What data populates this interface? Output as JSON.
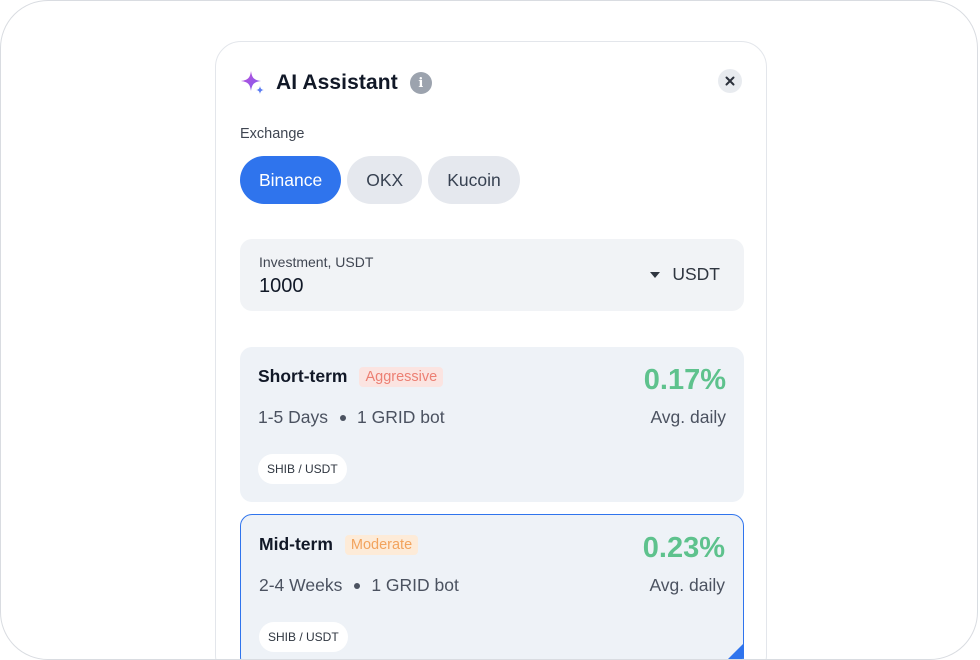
{
  "assistant": {
    "title": "AI Assistant",
    "info_icon_glyph": "i",
    "spark_icon": "sparkle-icon",
    "close_icon": "close-icon"
  },
  "exchange": {
    "label": "Exchange",
    "options": [
      {
        "label": "Binance",
        "active": true
      },
      {
        "label": "OKX",
        "active": false
      },
      {
        "label": "Kucoin",
        "active": false
      }
    ]
  },
  "investment": {
    "label": "Investment, USDT",
    "value": "1000",
    "currency": "USDT"
  },
  "strategies": [
    {
      "name": "Short-term",
      "risk": "Aggressive",
      "duration": "1-5 Days",
      "bots": "1 GRID bot",
      "pair": "SHIB / USDT",
      "return": "0.17%",
      "return_label": "Avg. daily"
    },
    {
      "name": "Mid-term",
      "risk": "Moderate",
      "duration": "2-4 Weeks",
      "bots": "1 GRID bot",
      "pair": "SHIB / USDT",
      "return": "0.23%",
      "return_label": "Avg. daily"
    }
  ],
  "colors": {
    "accent": "#2f74ed",
    "positive": "#5ec28d",
    "aggressive": "#ec7f73",
    "moderate": "#f2a35d"
  }
}
